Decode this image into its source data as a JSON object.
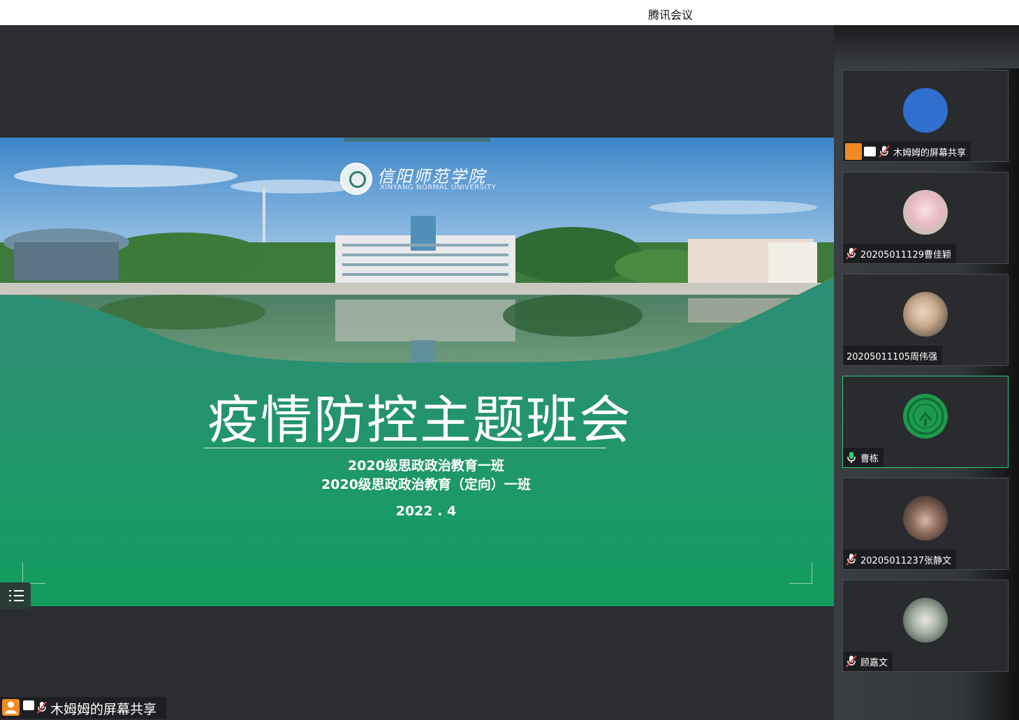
{
  "window": {
    "title": "腾讯会议"
  },
  "slide": {
    "logo_cn": "信阳师范学院",
    "logo_en": "XINYANG NORMAL UNIVERSITY",
    "title": "疫情防控主题班会",
    "subtitle_1": "2020级思政政治教育一班",
    "subtitle_2": "2020级思政政治教育（定向）一班",
    "date": "2022 . 4"
  },
  "share_badge": {
    "label": "木姆姆的屏幕共享"
  },
  "participants": [
    {
      "name": "木姆姆的屏幕共享",
      "avatar": "blue-circle",
      "mic": "muted",
      "sharing": true,
      "active": false
    },
    {
      "name": "20205011129曹佳颖",
      "avatar": "photo",
      "mic": "muted",
      "sharing": false,
      "active": false
    },
    {
      "name": "20205011105周伟强",
      "avatar": "photo",
      "mic": "none",
      "sharing": false,
      "active": false
    },
    {
      "name": "曹栋",
      "avatar": "university-logo",
      "mic": "on",
      "sharing": false,
      "active": true
    },
    {
      "name": "20205011237张静文",
      "avatar": "photo",
      "mic": "muted",
      "sharing": false,
      "active": false
    },
    {
      "name": "顾嘉文",
      "avatar": "photo",
      "mic": "muted",
      "sharing": false,
      "active": false
    }
  ],
  "colors": {
    "stage_bg": "#2b2d31",
    "active_border": "#2ecf7a",
    "mic_on": "#2ecf7a",
    "mic_muted": "#e04848",
    "share_person": "#f08a24",
    "avatar_blue": "#2f6fd0"
  }
}
